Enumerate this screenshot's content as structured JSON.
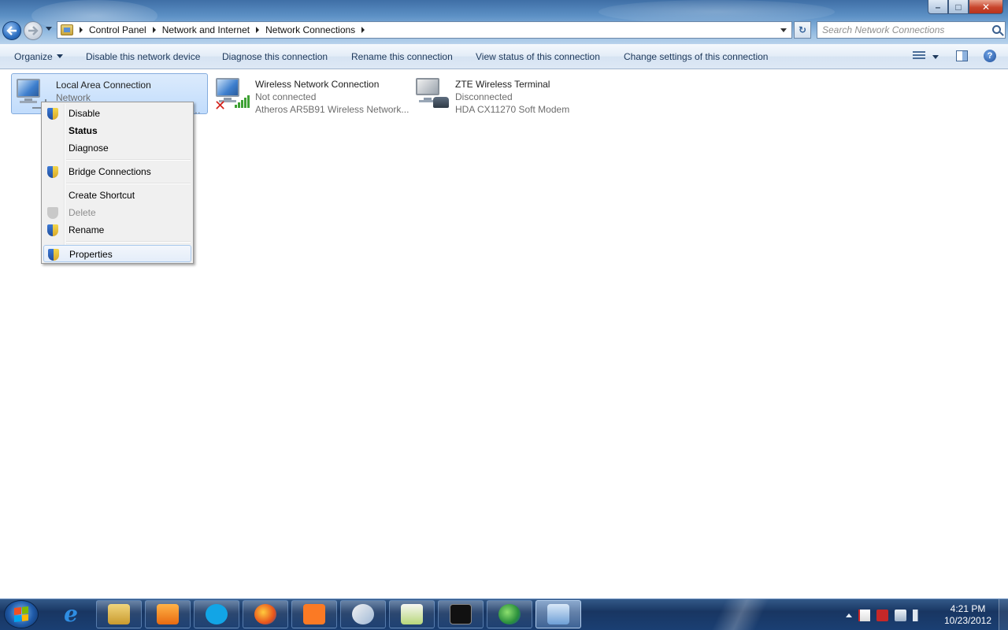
{
  "window": {
    "controls": {
      "minimize": "–",
      "maximize": "□",
      "close": "✕"
    }
  },
  "address_bar": {
    "crumbs": [
      "Control Panel",
      "Network and Internet",
      "Network Connections"
    ],
    "refresh_glyph": "↻"
  },
  "search": {
    "placeholder": "Search Network Connections"
  },
  "command_bar": {
    "organize": "Organize",
    "disable": "Disable this network device",
    "diagnose": "Diagnose this connection",
    "rename": "Rename this connection",
    "view_status": "View status of this connection",
    "change_settings": "Change settings of this connection",
    "help_glyph": "?"
  },
  "connections": [
    {
      "name": "Local Area Connection",
      "status": "Network",
      "device": "…",
      "icon": "wired-network-icon",
      "selected": true
    },
    {
      "name": "Wireless Network Connection",
      "status": "Not connected",
      "device": "Atheros AR5B91 Wireless Network...",
      "icon": "wireless-network-icon",
      "badge": "red-x-icon"
    },
    {
      "name": "ZTE Wireless Terminal",
      "status": "Disconnected",
      "device": "HDA CX11270 Soft Modem",
      "icon": "dialup-modem-icon"
    }
  ],
  "context_menu": {
    "items": [
      {
        "label": "Disable",
        "shield": true
      },
      {
        "label": "Status",
        "bold": true
      },
      {
        "label": "Diagnose"
      },
      {
        "label": "Bridge Connections",
        "shield": true
      },
      {
        "label": "Create Shortcut"
      },
      {
        "label": "Delete",
        "shield": true,
        "disabled": true
      },
      {
        "label": "Rename",
        "shield": true
      },
      {
        "label": "Properties",
        "shield": true,
        "highlighted": true
      }
    ]
  },
  "taskbar": {
    "apps": [
      "internet-explorer",
      "windows-explorer",
      "media-player",
      "skype",
      "firefox",
      "xampp",
      "paint",
      "notepad-plus-plus",
      "command-prompt",
      "network-globe",
      "control-panel"
    ],
    "clock": {
      "time": "4:21 PM",
      "date": "10/23/2012"
    }
  },
  "colors": {
    "accent": "#2c6fc1",
    "selection": "#c1dcfc",
    "link_text": "#1e395b"
  }
}
